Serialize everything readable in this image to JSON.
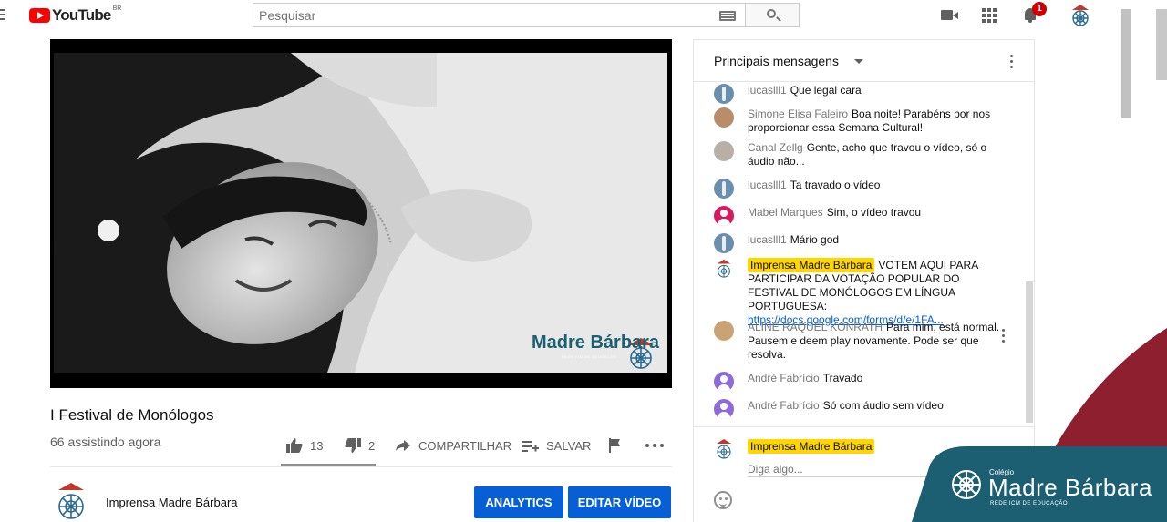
{
  "topbar": {
    "logo_text": "YouTube",
    "country_code": "BR",
    "search_placeholder": "Pesquisar",
    "notification_count": "1"
  },
  "video": {
    "overlay_logo_text": "Madre Bárbara",
    "overlay_logo_subtitle": "REDE ICM DE EDUCAÇÃO",
    "title": "I Festival de Monólogos",
    "watching": "66 assistindo agora",
    "likes": "13",
    "dislikes": "2",
    "share_label": "COMPARTILHAR",
    "save_label": "SALVAR"
  },
  "channel": {
    "name": "Imprensa Madre Bárbara",
    "analytics_label": "ANALYTICS",
    "edit_label": "EDITAR VÍDEO"
  },
  "chat": {
    "title": "Principais mensagens",
    "messages": [
      {
        "author": "lucaslll1",
        "text": "Que legal cara",
        "avatar": "blue-figure"
      },
      {
        "author": "Simone Elisa Faleiro",
        "text": "Boa noite! Parabéns por nos proporcionar essa Semana Cultural!",
        "avatar": "photo-woman"
      },
      {
        "author": "Canal Zellg",
        "text": "Gente, acho que travou o vídeo, só o áudio não...",
        "avatar": "photo-grey"
      },
      {
        "author": "lucaslll1",
        "text": "Ta travado o vídeo",
        "avatar": "blue-figure"
      },
      {
        "author": "Mabel Marques",
        "text": "Sim, o vídeo travou",
        "avatar": "pink-person"
      },
      {
        "author": "lucaslll1",
        "text": "Mário god",
        "avatar": "blue-figure"
      },
      {
        "author": "Imprensa Madre Bárbara",
        "text": "VOTEM AQUI PARA PARTICIPAR DA VOTAÇÃO POPULAR DO FESTIVAL DE MONÓLOGOS EM LÍNGUA PORTUGUESA: ",
        "link": "https://docs.google.com/forms/d/e/1FA...",
        "owner": true,
        "avatar": "seal"
      },
      {
        "author": "ALINE RAQUEL KONRATH",
        "text": "Para mim, está normal. Pausem e deem play novamente. Pode ser que resolva.",
        "avatar": "photo-blonde"
      },
      {
        "author": "André Fabrício",
        "text": "Travado",
        "avatar": "purple-person"
      },
      {
        "author": "André Fabrício",
        "text": "Só com áudio sem vídeo",
        "avatar": "purple-person"
      }
    ],
    "input_author": "Imprensa Madre Bárbara",
    "input_placeholder": "Diga algo..."
  },
  "brand": {
    "prefix": "Colégio",
    "name": "Madre Bárbara",
    "subtitle": "REDE ICM DE EDUCAÇÃO"
  },
  "colors": {
    "youtube_red": "#ff0000",
    "button_blue": "#065fd4",
    "owner_highlight": "#ffd600",
    "brand_teal": "#1d5f72",
    "brand_maroon": "#8e1f2f",
    "seal_blue": "#2c6a90"
  }
}
